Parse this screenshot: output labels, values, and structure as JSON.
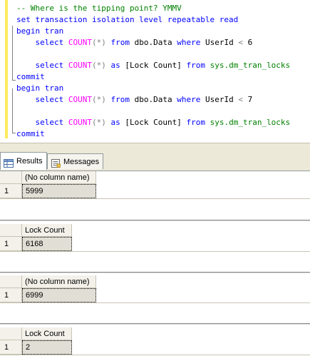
{
  "editor": {
    "lines": [
      {
        "parts": [
          {
            "t": "-- Where is the tipping point? YMMV",
            "c": "cm"
          }
        ]
      },
      {
        "parts": [
          {
            "t": "set transaction isolation level repeatable read",
            "c": "kw"
          }
        ]
      },
      {
        "parts": [
          {
            "t": "begin tran",
            "c": "kw"
          }
        ]
      },
      {
        "parts": [
          {
            "t": "    ",
            "c": ""
          },
          {
            "t": "select",
            "c": "kw"
          },
          {
            "t": " ",
            "c": ""
          },
          {
            "t": "COUNT",
            "c": "fn"
          },
          {
            "t": "(*)",
            "c": "gr"
          },
          {
            "t": " ",
            "c": ""
          },
          {
            "t": "from",
            "c": "kw"
          },
          {
            "t": " dbo.Data ",
            "c": ""
          },
          {
            "t": "where",
            "c": "kw"
          },
          {
            "t": " UserId ",
            "c": ""
          },
          {
            "t": "<",
            "c": "gr"
          },
          {
            "t": " 6",
            "c": ""
          }
        ]
      },
      {
        "parts": [
          {
            "t": "",
            "c": ""
          }
        ]
      },
      {
        "parts": [
          {
            "t": "    ",
            "c": ""
          },
          {
            "t": "select",
            "c": "kw"
          },
          {
            "t": " ",
            "c": ""
          },
          {
            "t": "COUNT",
            "c": "fn"
          },
          {
            "t": "(*)",
            "c": "gr"
          },
          {
            "t": " ",
            "c": ""
          },
          {
            "t": "as",
            "c": "kw"
          },
          {
            "t": " [Lock Count] ",
            "c": ""
          },
          {
            "t": "from",
            "c": "kw"
          },
          {
            "t": " ",
            "c": ""
          },
          {
            "t": "sys.dm_tran_locks",
            "c": "sy"
          }
        ]
      },
      {
        "parts": [
          {
            "t": "commit",
            "c": "kw"
          }
        ]
      },
      {
        "parts": [
          {
            "t": "begin tran",
            "c": "kw"
          }
        ]
      },
      {
        "parts": [
          {
            "t": "    ",
            "c": ""
          },
          {
            "t": "select",
            "c": "kw"
          },
          {
            "t": " ",
            "c": ""
          },
          {
            "t": "COUNT",
            "c": "fn"
          },
          {
            "t": "(*)",
            "c": "gr"
          },
          {
            "t": " ",
            "c": ""
          },
          {
            "t": "from",
            "c": "kw"
          },
          {
            "t": " dbo.Data ",
            "c": ""
          },
          {
            "t": "where",
            "c": "kw"
          },
          {
            "t": " UserId ",
            "c": ""
          },
          {
            "t": "<",
            "c": "gr"
          },
          {
            "t": " 7",
            "c": ""
          }
        ]
      },
      {
        "parts": [
          {
            "t": "",
            "c": ""
          }
        ]
      },
      {
        "parts": [
          {
            "t": "    ",
            "c": ""
          },
          {
            "t": "select",
            "c": "kw"
          },
          {
            "t": " ",
            "c": ""
          },
          {
            "t": "COUNT",
            "c": "fn"
          },
          {
            "t": "(*)",
            "c": "gr"
          },
          {
            "t": " ",
            "c": ""
          },
          {
            "t": "as",
            "c": "kw"
          },
          {
            "t": " [Lock Count] ",
            "c": ""
          },
          {
            "t": "from",
            "c": "kw"
          },
          {
            "t": " ",
            "c": ""
          },
          {
            "t": "sys.dm_tran_locks",
            "c": "sy"
          }
        ]
      },
      {
        "parts": [
          {
            "t": "commit",
            "c": "kw"
          }
        ]
      }
    ]
  },
  "tabs": [
    {
      "label": "Results",
      "icon": "grid-icon",
      "active": true
    },
    {
      "label": "Messages",
      "icon": "messages-icon",
      "active": false
    }
  ],
  "result_grids": [
    {
      "column": "(No column name)",
      "row_number": "1",
      "value": "5999"
    },
    {
      "column": "Lock Count",
      "row_number": "1",
      "value": "6168"
    },
    {
      "column": "(No column name)",
      "row_number": "1",
      "value": "6999"
    },
    {
      "column": "Lock Count",
      "row_number": "1",
      "value": "2"
    }
  ],
  "colors": {
    "keyword": "#0000ff",
    "function": "#ff00ff",
    "comment": "#008000",
    "system_object": "#008000",
    "operator": "#808080",
    "change_margin": "#fdeb5d"
  }
}
